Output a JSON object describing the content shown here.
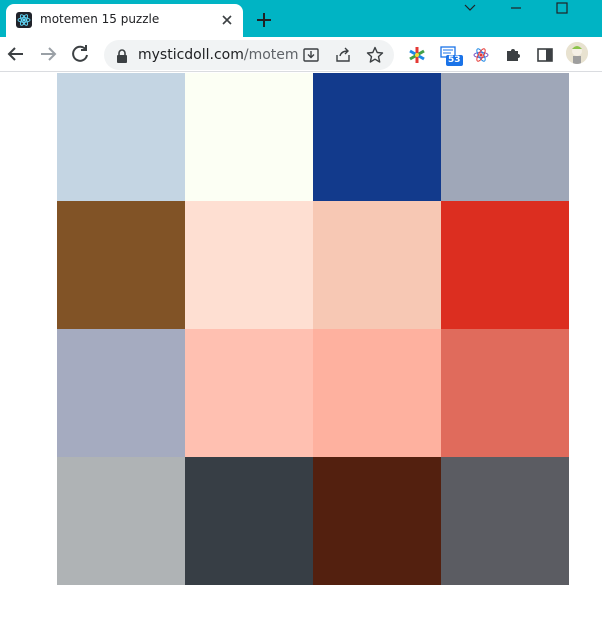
{
  "browser": {
    "tab": {
      "title": "motemen 15 puzzle",
      "favicon": "react-icon",
      "close_icon": "close-icon"
    },
    "new_tab_icon": "plus-icon",
    "window_controls": [
      "chevron-down-icon",
      "minimize-icon",
      "maximize-icon"
    ],
    "nav": [
      "back-arrow-icon",
      "forward-arrow-icon",
      "reload-icon"
    ],
    "address_bar": {
      "host": "mysticdoll.com",
      "path": "/motem...",
      "lock_icon": "lock-icon"
    },
    "omnibox_actions": [
      "install-app-icon",
      "share-icon",
      "bookmark-star-icon"
    ],
    "extensions": [
      {
        "name": "colorful-asterisk-icon"
      },
      {
        "name": "tab-counter-icon",
        "badge": "53"
      },
      {
        "name": "react-devtools-icon"
      },
      {
        "name": "puzzle-piece-icon"
      },
      {
        "name": "side-panel-icon"
      },
      {
        "name": "profile-avatar"
      }
    ]
  },
  "puzzle": {
    "tiles": [
      {
        "color": "#c4d5e3"
      },
      {
        "color": "#fcfff4"
      },
      {
        "color": "#123a8c"
      },
      {
        "color": "#9fa7b8"
      },
      {
        "color": "#815326"
      },
      {
        "color": "#fedfd2"
      },
      {
        "color": "#f7c8b4"
      },
      {
        "color": "#dc2e20"
      },
      {
        "color": "#a5abc0"
      },
      {
        "color": "#ffc0b1"
      },
      {
        "color": "#feb19f"
      },
      {
        "color": "#e06b5c"
      },
      {
        "color": "#afb3b5"
      },
      {
        "color": "#373e45"
      },
      {
        "color": "#53200f"
      },
      {
        "color": "#5b5c62"
      }
    ]
  }
}
